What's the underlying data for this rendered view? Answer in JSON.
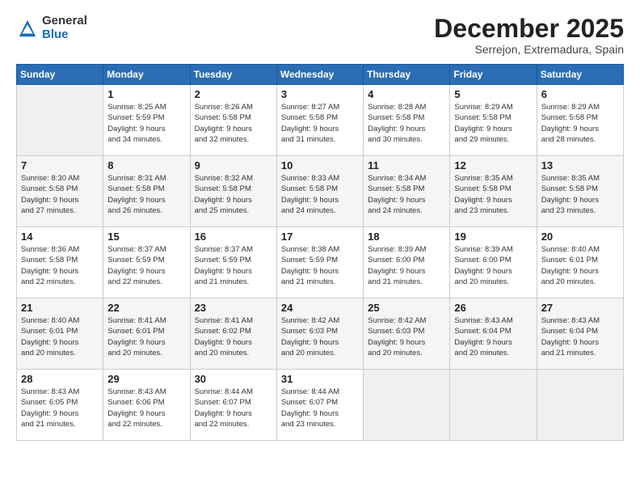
{
  "header": {
    "logo": {
      "line1": "General",
      "line2": "Blue"
    },
    "title": "December 2025",
    "location": "Serrejon, Extremadura, Spain"
  },
  "weekdays": [
    "Sunday",
    "Monday",
    "Tuesday",
    "Wednesday",
    "Thursday",
    "Friday",
    "Saturday"
  ],
  "weeks": [
    [
      {
        "day": "",
        "info": ""
      },
      {
        "day": "1",
        "info": "Sunrise: 8:25 AM\nSunset: 5:59 PM\nDaylight: 9 hours\nand 34 minutes."
      },
      {
        "day": "2",
        "info": "Sunrise: 8:26 AM\nSunset: 5:58 PM\nDaylight: 9 hours\nand 32 minutes."
      },
      {
        "day": "3",
        "info": "Sunrise: 8:27 AM\nSunset: 5:58 PM\nDaylight: 9 hours\nand 31 minutes."
      },
      {
        "day": "4",
        "info": "Sunrise: 8:28 AM\nSunset: 5:58 PM\nDaylight: 9 hours\nand 30 minutes."
      },
      {
        "day": "5",
        "info": "Sunrise: 8:29 AM\nSunset: 5:58 PM\nDaylight: 9 hours\nand 29 minutes."
      },
      {
        "day": "6",
        "info": "Sunrise: 8:29 AM\nSunset: 5:58 PM\nDaylight: 9 hours\nand 28 minutes."
      }
    ],
    [
      {
        "day": "7",
        "info": "Sunrise: 8:30 AM\nSunset: 5:58 PM\nDaylight: 9 hours\nand 27 minutes."
      },
      {
        "day": "8",
        "info": "Sunrise: 8:31 AM\nSunset: 5:58 PM\nDaylight: 9 hours\nand 26 minutes."
      },
      {
        "day": "9",
        "info": "Sunrise: 8:32 AM\nSunset: 5:58 PM\nDaylight: 9 hours\nand 25 minutes."
      },
      {
        "day": "10",
        "info": "Sunrise: 8:33 AM\nSunset: 5:58 PM\nDaylight: 9 hours\nand 24 minutes."
      },
      {
        "day": "11",
        "info": "Sunrise: 8:34 AM\nSunset: 5:58 PM\nDaylight: 9 hours\nand 24 minutes."
      },
      {
        "day": "12",
        "info": "Sunrise: 8:35 AM\nSunset: 5:58 PM\nDaylight: 9 hours\nand 23 minutes."
      },
      {
        "day": "13",
        "info": "Sunrise: 8:35 AM\nSunset: 5:58 PM\nDaylight: 9 hours\nand 23 minutes."
      }
    ],
    [
      {
        "day": "14",
        "info": "Sunrise: 8:36 AM\nSunset: 5:58 PM\nDaylight: 9 hours\nand 22 minutes."
      },
      {
        "day": "15",
        "info": "Sunrise: 8:37 AM\nSunset: 5:59 PM\nDaylight: 9 hours\nand 22 minutes."
      },
      {
        "day": "16",
        "info": "Sunrise: 8:37 AM\nSunset: 5:59 PM\nDaylight: 9 hours\nand 21 minutes."
      },
      {
        "day": "17",
        "info": "Sunrise: 8:38 AM\nSunset: 5:59 PM\nDaylight: 9 hours\nand 21 minutes."
      },
      {
        "day": "18",
        "info": "Sunrise: 8:39 AM\nSunset: 6:00 PM\nDaylight: 9 hours\nand 21 minutes."
      },
      {
        "day": "19",
        "info": "Sunrise: 8:39 AM\nSunset: 6:00 PM\nDaylight: 9 hours\nand 20 minutes."
      },
      {
        "day": "20",
        "info": "Sunrise: 8:40 AM\nSunset: 6:01 PM\nDaylight: 9 hours\nand 20 minutes."
      }
    ],
    [
      {
        "day": "21",
        "info": "Sunrise: 8:40 AM\nSunset: 6:01 PM\nDaylight: 9 hours\nand 20 minutes."
      },
      {
        "day": "22",
        "info": "Sunrise: 8:41 AM\nSunset: 6:01 PM\nDaylight: 9 hours\nand 20 minutes."
      },
      {
        "day": "23",
        "info": "Sunrise: 8:41 AM\nSunset: 6:02 PM\nDaylight: 9 hours\nand 20 minutes."
      },
      {
        "day": "24",
        "info": "Sunrise: 8:42 AM\nSunset: 6:03 PM\nDaylight: 9 hours\nand 20 minutes."
      },
      {
        "day": "25",
        "info": "Sunrise: 8:42 AM\nSunset: 6:03 PM\nDaylight: 9 hours\nand 20 minutes."
      },
      {
        "day": "26",
        "info": "Sunrise: 8:43 AM\nSunset: 6:04 PM\nDaylight: 9 hours\nand 20 minutes."
      },
      {
        "day": "27",
        "info": "Sunrise: 8:43 AM\nSunset: 6:04 PM\nDaylight: 9 hours\nand 21 minutes."
      }
    ],
    [
      {
        "day": "28",
        "info": "Sunrise: 8:43 AM\nSunset: 6:05 PM\nDaylight: 9 hours\nand 21 minutes."
      },
      {
        "day": "29",
        "info": "Sunrise: 8:43 AM\nSunset: 6:06 PM\nDaylight: 9 hours\nand 22 minutes."
      },
      {
        "day": "30",
        "info": "Sunrise: 8:44 AM\nSunset: 6:07 PM\nDaylight: 9 hours\nand 22 minutes."
      },
      {
        "day": "31",
        "info": "Sunrise: 8:44 AM\nSunset: 6:07 PM\nDaylight: 9 hours\nand 23 minutes."
      },
      {
        "day": "",
        "info": ""
      },
      {
        "day": "",
        "info": ""
      },
      {
        "day": "",
        "info": ""
      }
    ]
  ]
}
